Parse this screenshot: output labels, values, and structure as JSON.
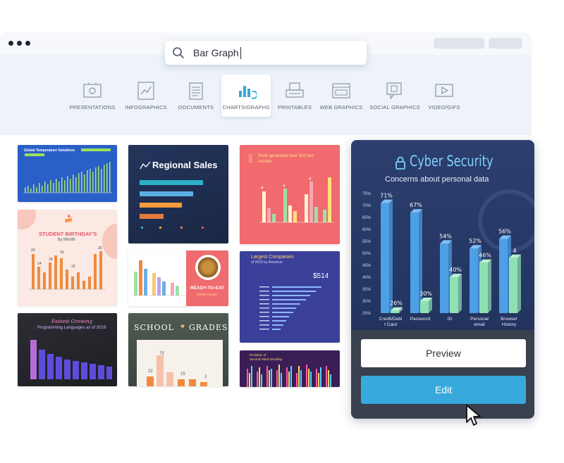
{
  "search": {
    "value": "Bar Graph"
  },
  "categories": [
    {
      "label": "PRESENTATIONS",
      "icon": "presentation-icon"
    },
    {
      "label": "INFOGRAPHICS",
      "icon": "infographic-icon"
    },
    {
      "label": "DOCUMENTS",
      "icon": "document-icon"
    },
    {
      "label": "CHARTS/GRAPHS",
      "icon": "chart-icon",
      "active": true
    },
    {
      "label": "PRINTABLES",
      "icon": "printer-icon"
    },
    {
      "label": "WEB GRAPHICS",
      "icon": "web-graphic-icon"
    },
    {
      "label": "SOCIAL GRAPHICS",
      "icon": "social-graphic-icon"
    },
    {
      "label": "VIDEO/GIFS",
      "icon": "video-icon"
    }
  ],
  "templates": {
    "t1": {
      "title": "Global Temperature Variations"
    },
    "t2": {
      "title": "Regional Sales"
    },
    "t3": {
      "title": "Profit generated over first four months",
      "side": "2021",
      "values": [
        "4",
        "4",
        "4"
      ]
    },
    "t4": {
      "title": "STUDENT BIRTHDAY'S",
      "subtitle": "by Month",
      "values": [
        "23",
        "14",
        "18",
        "16",
        "12",
        "20"
      ]
    },
    "t5": {
      "title": "READY-TO-EAT",
      "subtitle": "FOOD SALES"
    },
    "t6": {
      "title": "Largest Companies",
      "subtitle": "of 2019 by Revenue",
      "value": "$514"
    },
    "t7": {
      "title": "Fastest Growing",
      "subtitle": "Programming Languages as of 2018"
    },
    "t8": {
      "title": "SCHOOL",
      "title2": "GRADES",
      "values": [
        "75",
        "22",
        "15",
        "2"
      ]
    },
    "t9": {
      "title": "Evolution of",
      "subtitle": "Second Hand Smoking"
    }
  },
  "featured": {
    "title": "Cyber Security",
    "subtitle": "Concerns about personal data",
    "preview_label": "Preview",
    "edit_label": "Edit",
    "chart_data": {
      "type": "bar",
      "categories": [
        "Credit/Debit Card",
        "Password",
        "ID",
        "Personal email",
        "Browser History"
      ],
      "category_labels": [
        [
          "Credit/Debi",
          "t Card"
        ],
        [
          "Password"
        ],
        [
          "ID"
        ],
        [
          "Personal",
          "email"
        ],
        [
          "Browser",
          "History"
        ]
      ],
      "series": [
        {
          "values": [
            71,
            67,
            54,
            52,
            56
          ]
        },
        {
          "values": [
            26,
            30,
            40,
            46,
            48
          ]
        }
      ],
      "value_labels": [
        [
          "71%",
          "67%",
          "54%",
          "52%",
          "56%"
        ],
        [
          "26%",
          "30%",
          "40%",
          "46%",
          "4"
        ]
      ],
      "yticks": [
        "75%",
        "70%",
        "65%",
        "60%",
        "55%",
        "50%",
        "45%",
        "40%",
        "35%",
        "30%",
        "25%"
      ],
      "ylim": [
        25,
        75
      ],
      "colors": [
        "#4d9fe6",
        "#8fe0b3"
      ]
    }
  }
}
